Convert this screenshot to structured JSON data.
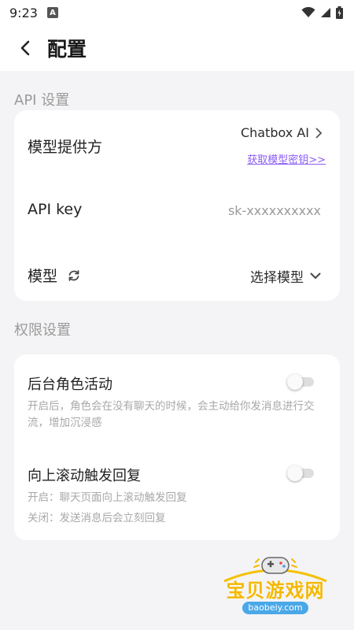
{
  "status_bar": {
    "time": "9:23",
    "notification_letter": "A"
  },
  "header": {
    "title": "配置"
  },
  "api_section": {
    "title": "API 设置",
    "provider": {
      "label": "模型提供方",
      "value": "Chatbox AI",
      "link": "获取模型密钥>>"
    },
    "api_key": {
      "label": "API key",
      "placeholder": "sk-xxxxxxxxxx"
    },
    "model": {
      "label": "模型",
      "value": "选择模型"
    }
  },
  "permission_section": {
    "title": "权限设置",
    "background_activity": {
      "label": "后台角色活动",
      "description": "开启后，角色会在没有聊天的时候，会主动给你发消息进行交流，增加沉浸感",
      "enabled": false
    },
    "scroll_reply": {
      "label": "向上滚动触发回复",
      "desc_on": "开启：聊天页面向上滚动触发回复",
      "desc_off": "关闭：发送消息后会立刻回复",
      "enabled": false
    }
  },
  "watermark": {
    "text": "宝贝游戏网",
    "url": "baobeiy.com"
  },
  "colors": {
    "accent_link": "#8b5cf6",
    "toggle_off": "#dedede",
    "watermark": "#f5b800"
  }
}
